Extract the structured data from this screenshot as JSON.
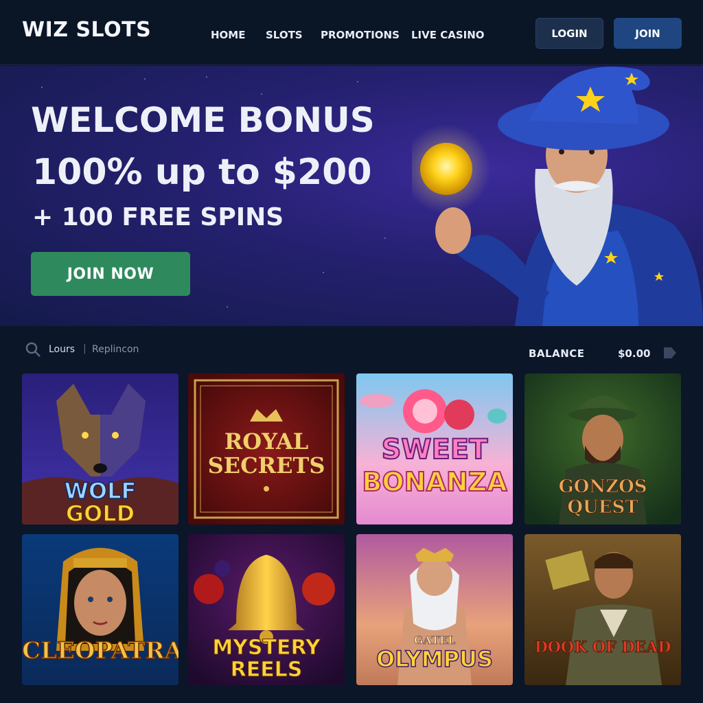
{
  "header": {
    "logo": "WIZ SLOTS",
    "nav": [
      "HOME",
      "SLOTS",
      "PROMOTIONS",
      "LIVE CASINO"
    ],
    "login_label": "LOGIN",
    "join_label": "JOIN"
  },
  "hero": {
    "title": "WELCOME BONUS",
    "offer": "100% up to $200",
    "spins": "+ 100 FREE SPINS",
    "cta_label": "JOIN NOW"
  },
  "toolbar": {
    "search_label": "Lours",
    "search_separator": "|",
    "search_secondary": "Replincon",
    "balance_label": "BALANCE",
    "balance_value": "$0.00"
  },
  "games": [
    {
      "line1": "WOLF",
      "line2": "GOLD"
    },
    {
      "line1": "ROYAL",
      "line2": "SECRETS"
    },
    {
      "line1": "SWEET",
      "line2": "BONANZA"
    },
    {
      "line1": "GONZOS QUEST",
      "line2": ""
    },
    {
      "line1": "CLEOPATRA",
      "line2": ""
    },
    {
      "line1": "MYSTERY",
      "line2": "REELS"
    },
    {
      "line1": "GATEL",
      "line2": "OLYMPUS"
    },
    {
      "line1": "DOOK OF DEAD",
      "line2": ""
    }
  ],
  "colors": {
    "page_bg": "#0b1628",
    "header_bg": "#0a1526",
    "cta_green": "#2e8a5c",
    "join_blue": "#1f4680",
    "login_bg": "#1c2f4d"
  }
}
